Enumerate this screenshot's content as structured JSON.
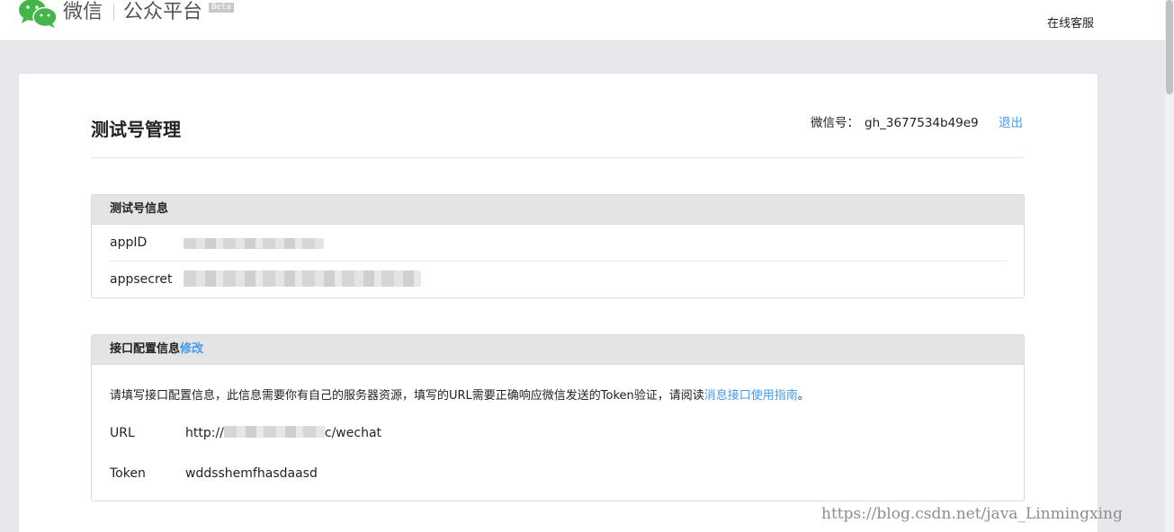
{
  "header": {
    "brand_name": "微信",
    "brand_sub": "公众平台",
    "beta": "Beta",
    "service_link": "在线客服"
  },
  "page": {
    "title": "测试号管理",
    "account_label": "微信号：",
    "account_value": "gh_3677534b49e9",
    "logout": "退出"
  },
  "test_account": {
    "heading": "测试号信息",
    "appid_label": "appID",
    "appsecret_label": "appsecret"
  },
  "interface_config": {
    "heading": "接口配置信息",
    "edit": "修改",
    "desc_text": "请填写接口配置信息，此信息需要你有自己的服务器资源，填写的URL需要正确响应微信发送的Token验证，请阅读",
    "desc_link": "消息接口使用指南",
    "desc_end": "。",
    "url_label": "URL",
    "url_prefix": "http://",
    "url_suffix": "c/wechat",
    "token_label": "Token",
    "token_value": "wddsshemfhasdaasd"
  },
  "watermark": "https://blog.csdn.net/java_Linmingxing",
  "colors": {
    "link": "#459ae9",
    "wechat_green": "#44b549"
  }
}
